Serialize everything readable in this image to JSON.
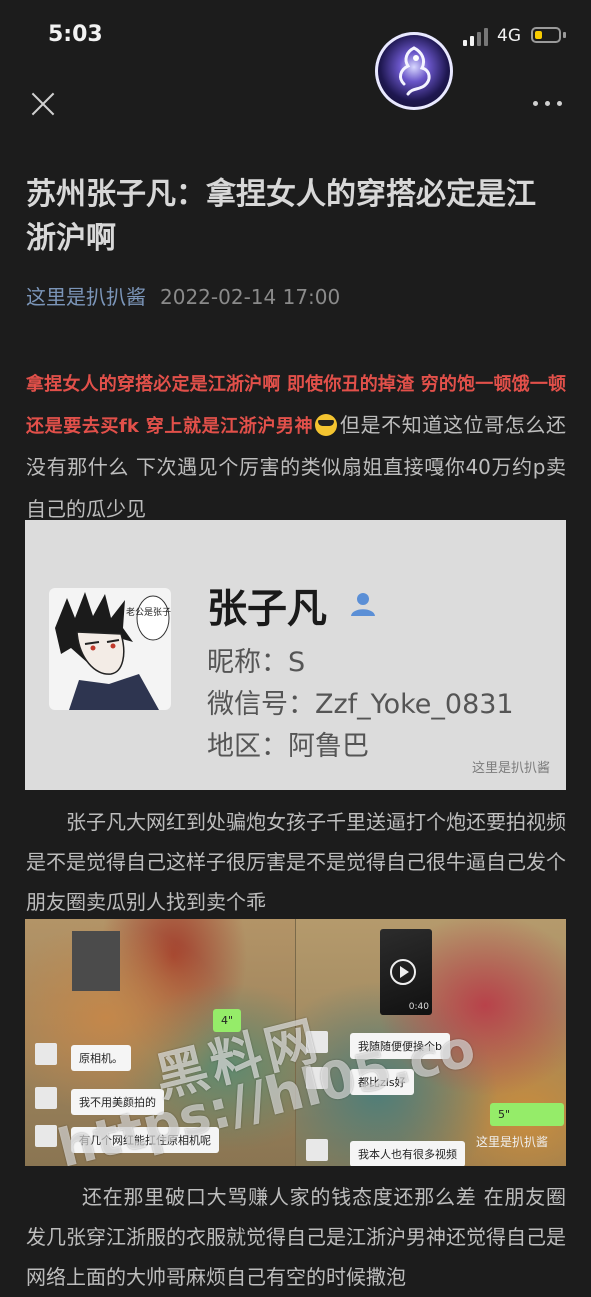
{
  "status_bar": {
    "time": "5:03",
    "network": "4G"
  },
  "article": {
    "title": "苏州张子凡：拿捏女人的穿搭必定是江浙沪啊",
    "author": "这里是扒扒酱",
    "date": "2022-02-14 17:00",
    "p1_highlight": "拿捏女人的穿搭必定是江浙沪啊 即使你丑的掉渣 穷的饱一顿饿一顿 还是要去买fk 穿上就是江浙沪男神",
    "p1_rest": "但是不知道这位哥怎么还没有那什么 下次遇见个厉害的类似扇姐直接嘎你40万约p卖自己的瓜少见",
    "p2": "张子凡大网红到处骗炮女孩子千里送逼打个炮还要拍视频是不是觉得自己这样子很厉害是不是觉得自己很牛逼自己发个朋友圈卖瓜别人找到卖个乖",
    "p3": "还在那里破口大骂赚人家的钱态度还那么差 在朋友圈发几张穿江浙服的衣服就觉得自己是江浙沪男神还觉得自己是网络上面的大帅哥麻烦自己有空的时候撒泡"
  },
  "profile_card": {
    "avatar_caption": "老公是张子凡",
    "name": "张子凡",
    "nickname": "昵称：S",
    "wechat_id": "微信号：Zzf_Yoke_0831",
    "region": "地区：阿鲁巴",
    "watermark": "这里是扒扒酱"
  },
  "chat_screens": {
    "left": {
      "voice": "4\"",
      "msg1": "原相机。",
      "msg2": "我不用美颜拍的",
      "msg3": "有几个网红能扛住原相机呢"
    },
    "right": {
      "video_time": "0:40",
      "msg1": "我随随便便操个b",
      "msg2": "都比zls好",
      "voice": "5\"",
      "msg3": "我本人也有很多视频"
    },
    "small_watermark": "这里是扒扒酱",
    "big_watermark_1": "黑料网",
    "big_watermark_2": "https://hl05.co"
  }
}
